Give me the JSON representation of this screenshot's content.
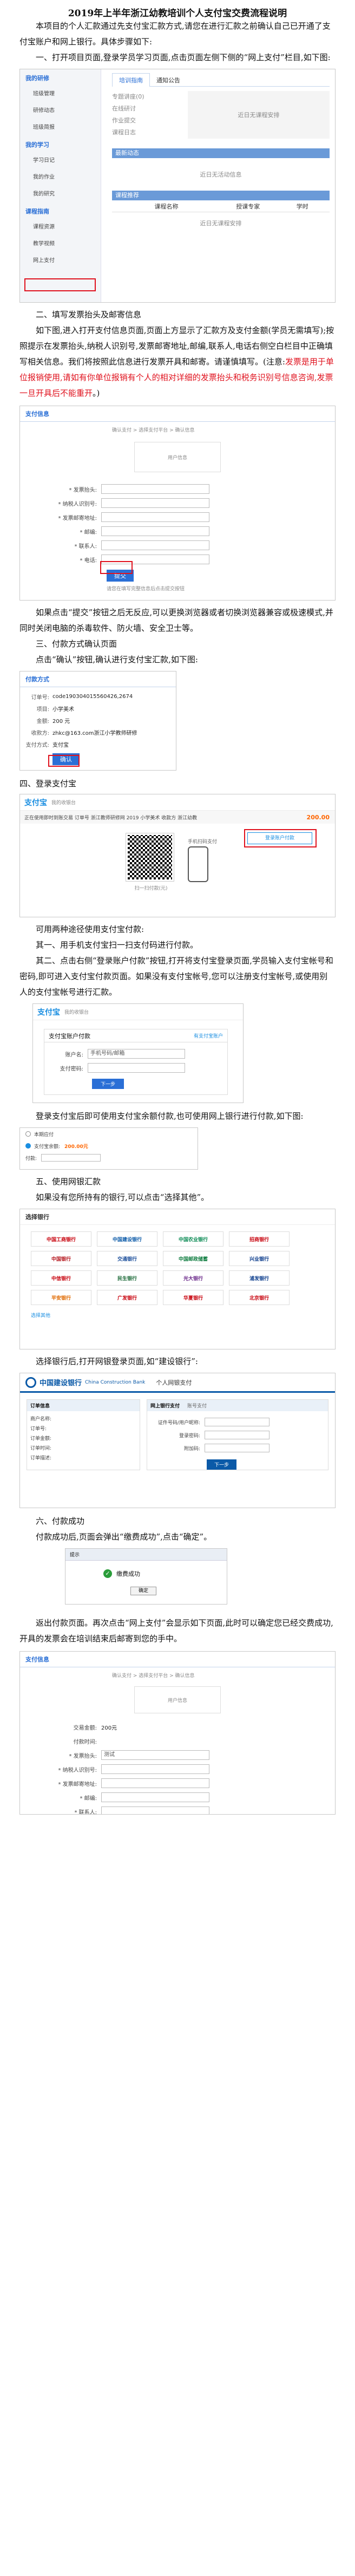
{
  "doc": {
    "title": "2019年上半年浙江幼教培训个人支付宝交费流程说明",
    "intro": "本项目的个人汇款通过先支付宝汇款方式,请您在进行汇款之前确认自己已开通了支付宝账户和网上银行。具体步骤如下:",
    "step1": "一、打开项目页面,登录学员学习页面,点击页面左侧下侧的“网上支付”栏目,如下图:",
    "step2_title": "二、填写发票抬头及邮寄信息",
    "step2_text_a": "如下图,进入打开支付信息页面,页面上方显示了汇款方及支付金额(学员无需填写);按照提示在发票抬头,纳税人识别号,发票邮寄地址,邮编,联系人,电话右侧空白栏目中正确填写相关信息。我们将按照此信息进行发票开具和邮寄。请谨慎填写。(注意:",
    "step2_red": "发票是用于单位报销使用,请如有你单位报销有个人的相对详细的发票抬头和税务识别号信息咨询,发票一旦开具后不能重开",
    "step2_text_b": "。)",
    "step2_after": "如果点击“提交”按钮之后无反应,可以更换浏览器或者切换浏览器兼容或极速模式,并同时关闭电脑的杀毒软件、防火墙、安全卫士等。",
    "step3_title": "三、付款方式确认页面",
    "step3_text": "点击“确认”按钮,确认进行支付宝汇款,如下图:",
    "step4_title": "四、登录支付宝",
    "step4_text_a": "可用两种途径使用支付宝付款:",
    "step4_text_b": "其一、用手机支付宝扫一扫支付码进行付款。",
    "step4_text_c": "其二、点击右侧“登录账户付款”按钮,打开将支付宝登录页面,学员输入支付宝帐号和密码,即可进入支付宝付款页面。如果没有支付宝帐号,您可以注册支付宝帐号,或使用别人的支付宝帐号进行汇款。",
    "step4_after": "登录支付宝后即可使用支付宝余额付款,也可使用网上银行进行付款,如下图:",
    "step5_title": "五、使用网银汇款",
    "step5_text": "如果没有您所持有的银行,可以点击“选择其他”。",
    "step5_after": "选择银行后,打开网银登录页面,如“建设银行”:",
    "step6_title": "六、付款成功",
    "step6_text": "付款成功后,页面会弹出“缴费成功”,点击“确定”。",
    "end_text": "返出付款页面。再次点击“网上支付”会显示如下页面,此时可以确定您已经交费成功,开具的发票会在培训结束后邮寄到您的手中。"
  },
  "shot1": {
    "tabs": [
      "培训指南",
      "通知公告"
    ],
    "sidebar": [
      "我的研修",
      "班级管理",
      "研修动态",
      "班级简报",
      "我的学习",
      "学习日记",
      "我的作业",
      "我的研究",
      "课程指南",
      "课程资源",
      "教学视频",
      "网上支付"
    ],
    "info": [
      "专题讲座(0)",
      "在线研讨",
      "作业提交",
      "课程日志"
    ],
    "table_header": [
      "课程名称",
      "授课专家",
      "学时"
    ],
    "notice_a": "近日无课程安排",
    "notice_b": "近日无活动信息",
    "section_a": "最新动态",
    "section_b": "课程推荐"
  },
  "shot2": {
    "header": "支付信息",
    "breadcrumb": "确认支付 > 选择支付平台 > 确认信息",
    "user_label": "用户信息",
    "fields": [
      {
        "label": "* 发票抬头:",
        "value": ""
      },
      {
        "label": "* 纳税人识别号:",
        "value": ""
      },
      {
        "label": "* 发票邮寄地址:",
        "value": ""
      },
      {
        "label": "* 邮编:",
        "value": ""
      },
      {
        "label": "* 联系人:",
        "value": ""
      },
      {
        "label": "* 电话:",
        "value": ""
      }
    ],
    "submit": "提交",
    "note": "请您在填写完整信息后点击提交按钮"
  },
  "shot3": {
    "header": "付款方式",
    "rows": [
      {
        "label": "订单号:",
        "value": "code190304015560426,2674"
      },
      {
        "label": "项目:",
        "value": "小学美术"
      },
      {
        "label": "金额:",
        "value": "200 元"
      },
      {
        "label": "收款方:",
        "value": "zhkc@163.com浙江小学教师研修"
      },
      {
        "label": "支付方式:",
        "value": "支付宝"
      }
    ],
    "confirm": "确认"
  },
  "shot4": {
    "logo": "支付宝",
    "logo_sub": "我的收银台",
    "order_text": "正在使用即时到账交易 订单号 浙江教师研修网 2019 小学美术 收款方 浙江幼教",
    "amount": "200.00",
    "scan_hint": "扫一扫付款(元)",
    "side_title": "手机扫码支付",
    "login_btn": "登录账户付款"
  },
  "shot5": {
    "logo": "支付宝",
    "logo_sub": "我的收银台",
    "tab_a": "支付宝账户付款",
    "tab_b": "有支付宝账户",
    "account_label": "账户名:",
    "account_ph": "手机号码/邮箱",
    "pwd_label": "支付密码:",
    "next_btn": "下一步"
  },
  "shot6": {
    "row1": "本期应付",
    "amount_label": "支付宝余额:",
    "amount": "200.00元",
    "pay_label": "付款:"
  },
  "shot7": {
    "header": "选择银行",
    "banks": [
      "中国工商银行",
      "中国建设银行",
      "中国农业银行",
      "招商银行",
      "中国银行",
      "交通银行",
      "中国邮政储蓄",
      "兴业银行",
      "中信银行",
      "民生银行",
      "光大银行",
      "浦发银行",
      "平安银行",
      "广发银行",
      "华夏银行",
      "北京银行"
    ],
    "other": "选择其他"
  },
  "shot8": {
    "bank_name": "中国建设银行",
    "bank_en": "China Construction Bank",
    "sys_name": "个人网银支付",
    "left_title": "订单信息",
    "left_rows": [
      "商户名称:",
      "订单号:",
      "订单金额:",
      "订单时间:",
      "订单描述:"
    ],
    "right_title": "网上银行支付",
    "right_tab_b": "账号支付",
    "right_rows": [
      "证件号码/用户昵称:",
      "登录密码:",
      "附加码:"
    ],
    "btn": "下一步"
  },
  "shot9": {
    "title": "提示",
    "message": "缴费成功",
    "ok": "确定"
  },
  "shot10": {
    "header": "支付信息",
    "breadcrumb": "确认支付 > 选择支付平台 > 确认信息",
    "user_label": "用户信息",
    "rows": [
      {
        "label": "交易金额:",
        "value": "200元"
      },
      {
        "label": "付款时间:",
        "value": ""
      },
      {
        "label": "* 发票抬头:",
        "value": "测试"
      },
      {
        "label": "* 纳税人识别号:",
        "value": ""
      },
      {
        "label": "* 发票邮寄地址:",
        "value": ""
      },
      {
        "label": "* 邮编:",
        "value": ""
      },
      {
        "label": "* 联系人:",
        "value": ""
      }
    ]
  }
}
